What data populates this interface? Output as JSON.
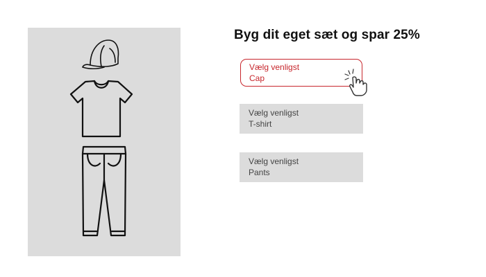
{
  "page": {
    "title": "Byg dit eget sæt og spar 25%"
  },
  "outfit": {
    "icons": [
      "cap-icon",
      "t-shirt-icon",
      "pants-icon"
    ]
  },
  "pickers": [
    {
      "prompt": "Vælg venligst",
      "item": "Cap",
      "state": "active"
    },
    {
      "prompt": "Vælg venligst",
      "item": "T-shirt",
      "state": "default"
    },
    {
      "prompt": "Vælg venligst",
      "item": "Pants",
      "state": "default"
    }
  ],
  "colors": {
    "accent": "#c7262c",
    "panel": "#dcdcdc",
    "text": "#111111"
  }
}
